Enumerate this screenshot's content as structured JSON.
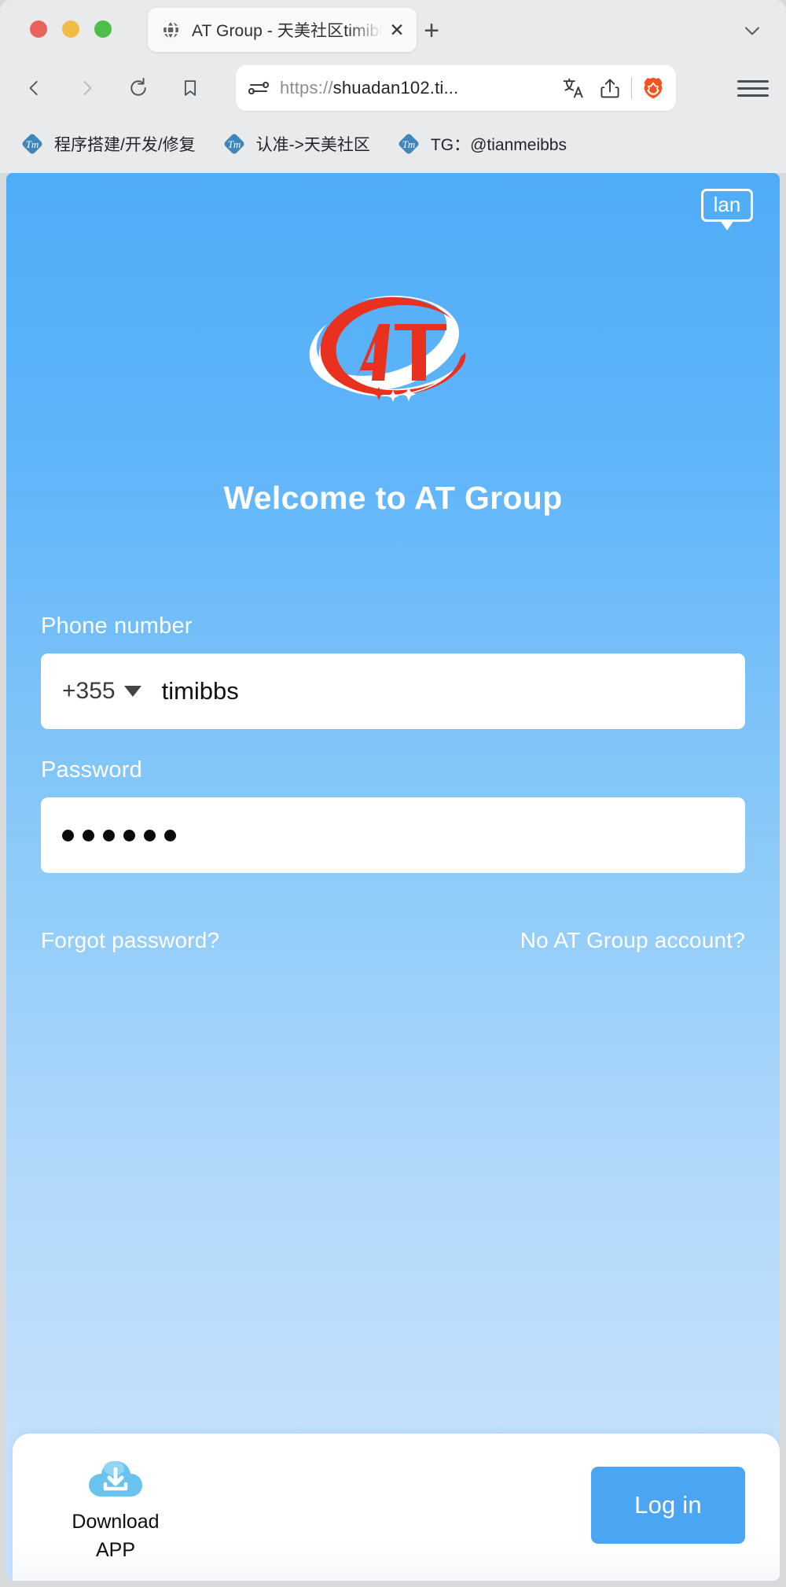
{
  "browser": {
    "window_controls": [
      "close",
      "minimize",
      "maximize"
    ],
    "tab": {
      "title": "AT Group - 天美社区timibbs.ne",
      "favicon": "globe-icon",
      "close_label": "✕"
    },
    "new_tab_label": "+",
    "tab_list_chevron": "chevron-down-icon",
    "nav": {
      "back": "back-arrow-icon",
      "forward": "forward-arrow-icon",
      "reload": "reload-icon",
      "bookmark": "bookmark-icon"
    },
    "omnibox": {
      "permission_icon": "site-settings-icon",
      "url_scheme": "https://",
      "url_host": "shuadan102.ti...",
      "translate_icon": "translate-icon",
      "share_icon": "share-icon",
      "shield_icon": "brave-lion-icon"
    },
    "menu_icon": "hamburger-menu-icon",
    "bookmarks": [
      {
        "icon": "tm-favicon",
        "label": "程序搭建/开发/修复"
      },
      {
        "icon": "tm-favicon",
        "label": "认准->天美社区"
      },
      {
        "icon": "tm-favicon",
        "label": "TG：@tianmeibbs"
      }
    ]
  },
  "page": {
    "language_button": {
      "label": "lan",
      "name": "language-switch-button"
    },
    "brand": {
      "logo_text": "AT",
      "logo_name": "at-group-logo"
    },
    "heading": "Welcome to AT Group",
    "form": {
      "phone": {
        "label": "Phone number",
        "country_code": "+355",
        "value": "timibbs",
        "placeholder": "Phone number"
      },
      "password": {
        "label": "Password",
        "masked_value": "••••••",
        "dot_count": 6,
        "placeholder": "Password"
      }
    },
    "links": {
      "forgot_password": "Forgot password?",
      "no_account": "No AT Group account?"
    },
    "bottom_bar": {
      "download_icon": "cloud-download-icon",
      "download_line1": "Download",
      "download_line2": "APP",
      "login_label": "Log in"
    },
    "colors": {
      "accent_blue": "#4aa6f2",
      "page_top_blue": "#4facf8",
      "page_bottom_blue": "#c9e2fc",
      "logo_red": "#e8321f",
      "brave_orange": "#f6521f",
      "bookmark_icon_blue": "#3f86bd"
    }
  }
}
